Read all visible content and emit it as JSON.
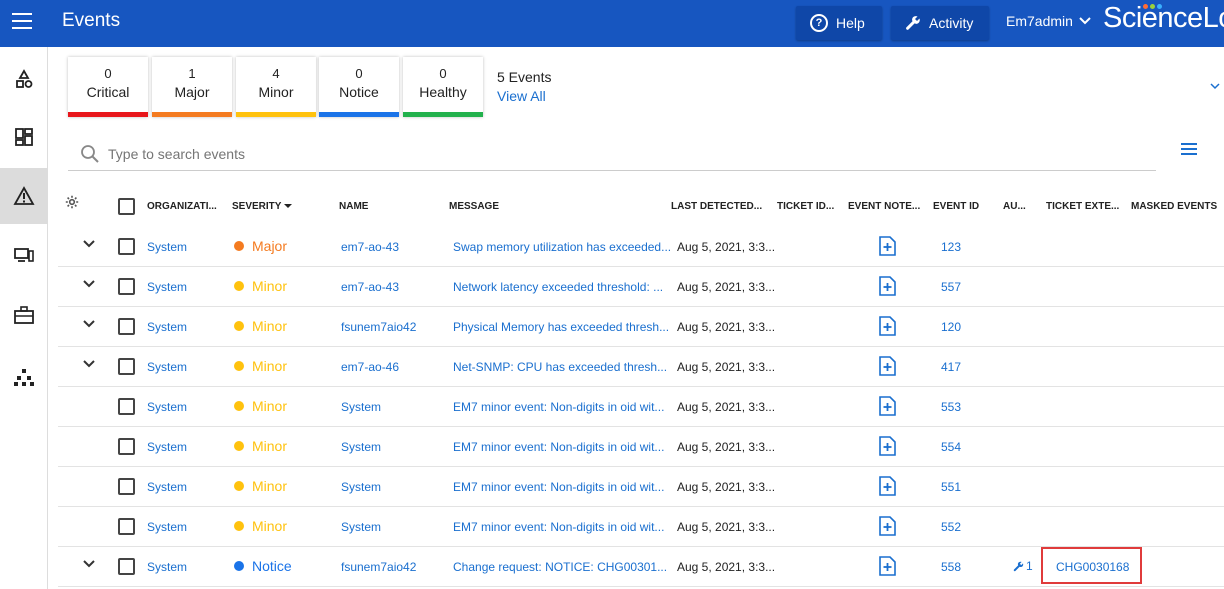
{
  "header": {
    "title": "Events",
    "help_label": "Help",
    "activity_label": "Activity",
    "user_label": "Em7admin",
    "logo_text": "ScienceLo"
  },
  "colors": {
    "primary": "#1756c0",
    "critical": "#e8161b",
    "major": "#f47b20",
    "minor": "#ffc20e",
    "notice": "#1a73e8",
    "healthy": "#22b14c",
    "link": "#1a6fcf"
  },
  "tiles": [
    {
      "count": "0",
      "label": "Critical",
      "color": "#e8161b"
    },
    {
      "count": "1",
      "label": "Major",
      "color": "#f47b20"
    },
    {
      "count": "4",
      "label": "Minor",
      "color": "#ffc20e"
    },
    {
      "count": "0",
      "label": "Notice",
      "color": "#1a73e8"
    },
    {
      "count": "0",
      "label": "Healthy",
      "color": "#22b14c"
    }
  ],
  "summary": {
    "events_count": "5 Events",
    "view_all": "View All"
  },
  "search": {
    "placeholder": "Type to search events"
  },
  "columns": {
    "organization": "ORGANIZATI...",
    "severity": "SEVERITY",
    "name": "NAME",
    "message": "MESSAGE",
    "last_detected": "LAST DETECTED...",
    "ticket_id": "TICKET ID...",
    "event_note": "EVENT NOTE...",
    "event_id": "EVENT ID",
    "au": "AU...",
    "ticket_external": "TICKET EXTE...",
    "masked_events": "MASKED EVENTS"
  },
  "rows": [
    {
      "expandable": true,
      "org": "System",
      "severity": "Major",
      "sev_color": "#f47b20",
      "name": "em7-ao-43",
      "message": "Swap memory utilization has exceeded...",
      "detected": "Aug 5, 2021, 3:3...",
      "event_id": "123",
      "au": "",
      "ticket_ext": ""
    },
    {
      "expandable": true,
      "org": "System",
      "severity": "Minor",
      "sev_color": "#ffc20e",
      "name": "em7-ao-43",
      "message": "Network latency exceeded threshold: ...",
      "detected": "Aug 5, 2021, 3:3...",
      "event_id": "557",
      "au": "",
      "ticket_ext": ""
    },
    {
      "expandable": true,
      "org": "System",
      "severity": "Minor",
      "sev_color": "#ffc20e",
      "name": "fsunem7aio42",
      "message": "Physical Memory has exceeded thresh...",
      "detected": "Aug 5, 2021, 3:3...",
      "event_id": "120",
      "au": "",
      "ticket_ext": ""
    },
    {
      "expandable": true,
      "org": "System",
      "severity": "Minor",
      "sev_color": "#ffc20e",
      "name": "em7-ao-46",
      "message": "Net-SNMP: CPU has exceeded thresh...",
      "detected": "Aug 5, 2021, 3:3...",
      "event_id": "417",
      "au": "",
      "ticket_ext": ""
    },
    {
      "expandable": false,
      "org": "System",
      "severity": "Minor",
      "sev_color": "#ffc20e",
      "name": "System",
      "message": "EM7 minor event: Non-digits in oid wit...",
      "detected": "Aug 5, 2021, 3:3...",
      "event_id": "553",
      "au": "",
      "ticket_ext": ""
    },
    {
      "expandable": false,
      "org": "System",
      "severity": "Minor",
      "sev_color": "#ffc20e",
      "name": "System",
      "message": "EM7 minor event: Non-digits in oid wit...",
      "detected": "Aug 5, 2021, 3:3...",
      "event_id": "554",
      "au": "",
      "ticket_ext": ""
    },
    {
      "expandable": false,
      "org": "System",
      "severity": "Minor",
      "sev_color": "#ffc20e",
      "name": "System",
      "message": "EM7 minor event: Non-digits in oid wit...",
      "detected": "Aug 5, 2021, 3:3...",
      "event_id": "551",
      "au": "",
      "ticket_ext": ""
    },
    {
      "expandable": false,
      "org": "System",
      "severity": "Minor",
      "sev_color": "#ffc20e",
      "name": "System",
      "message": "EM7 minor event: Non-digits in oid wit...",
      "detected": "Aug 5, 2021, 3:3...",
      "event_id": "552",
      "au": "",
      "ticket_ext": ""
    },
    {
      "expandable": true,
      "org": "System",
      "severity": "Notice",
      "sev_color": "#1a73e8",
      "name": "fsunem7aio42",
      "message": "Change request: NOTICE: CHG00301...",
      "detected": "Aug 5, 2021, 3:3...",
      "event_id": "558",
      "au": "1",
      "ticket_ext": "CHG0030168"
    }
  ]
}
